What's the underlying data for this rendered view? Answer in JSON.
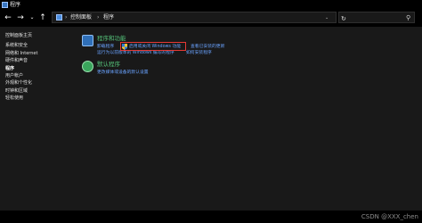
{
  "window": {
    "title": "程序"
  },
  "nav": {
    "back_icon": "arrow-left-icon",
    "forward_icon": "arrow-right-icon",
    "recent_icon": "chevron-down-icon",
    "up_icon": "arrow-up-icon",
    "breadcrumb": [
      "控制面板",
      "程序"
    ],
    "refresh_icon": "refresh-icon",
    "search_icon": "search-icon"
  },
  "sidebar": {
    "items": [
      {
        "label": "控制面板主页"
      },
      {
        "label": "系统和安全"
      },
      {
        "label": "网络和 Internet"
      },
      {
        "label": "硬件和声音"
      },
      {
        "label": "程序"
      },
      {
        "label": "用户帐户"
      },
      {
        "label": "外观和个性化"
      },
      {
        "label": "时钟和区域"
      },
      {
        "label": "轻松使用"
      }
    ],
    "current": "程序"
  },
  "programs_section": {
    "title": "程序和功能",
    "links": {
      "uninstall": "卸载程序",
      "windows_features": "启用或关闭 Windows 功能",
      "view_updates": "查看已安装的更新",
      "run_old_programs": "运行为以前版本的 Windows 编写的程序",
      "how_to_install": "如何安装程序"
    }
  },
  "default_section": {
    "title": "默认程序",
    "links": {
      "change_media": "更改媒体或设备的默认设置"
    }
  },
  "watermark": "CSDN @XXX_chen",
  "colors": {
    "link": "#6aa3ff",
    "section_title": "#55c37a",
    "highlight": "#e53935",
    "background": "#191919"
  }
}
